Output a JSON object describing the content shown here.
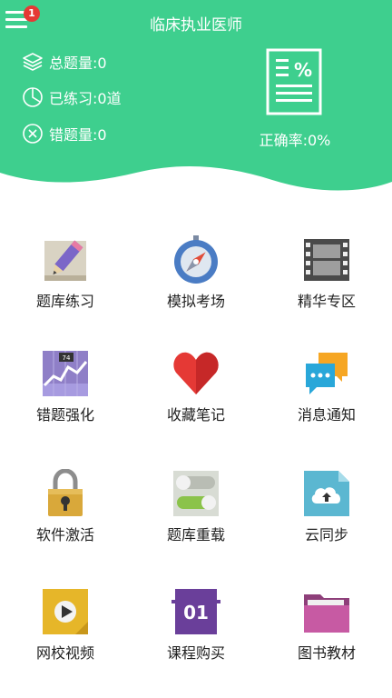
{
  "header": {
    "title": "临床执业医师",
    "badge_count": "1",
    "stats": [
      {
        "icon": "layers-icon",
        "text": "总题量:0"
      },
      {
        "icon": "pie-chart-icon",
        "text": "已练习:0道"
      },
      {
        "icon": "x-circle-icon",
        "text": "错题量:0"
      }
    ],
    "accuracy": "正确率:0%",
    "accuracy_icon": "document-percent-icon"
  },
  "grid": [
    {
      "label": "题库练习",
      "icon": "pencil-paper-icon"
    },
    {
      "label": "模拟考场",
      "icon": "compass-icon"
    },
    {
      "label": "精华专区",
      "icon": "film-strip-icon"
    },
    {
      "label": "错题强化",
      "icon": "trend-chart-icon"
    },
    {
      "label": "收藏笔记",
      "icon": "heart-icon"
    },
    {
      "label": "消息通知",
      "icon": "chat-bubbles-icon"
    },
    {
      "label": "软件激活",
      "icon": "padlock-icon"
    },
    {
      "label": "题库重载",
      "icon": "toggle-switches-icon"
    },
    {
      "label": "云同步",
      "icon": "cloud-upload-icon"
    },
    {
      "label": "网校视频",
      "icon": "video-play-icon"
    },
    {
      "label": "课程购买",
      "icon": "course-01-icon"
    },
    {
      "label": "图书教材",
      "icon": "folder-icon"
    }
  ],
  "colors": {
    "header_green": "#3ecf8e",
    "badge_red": "#e53935"
  }
}
